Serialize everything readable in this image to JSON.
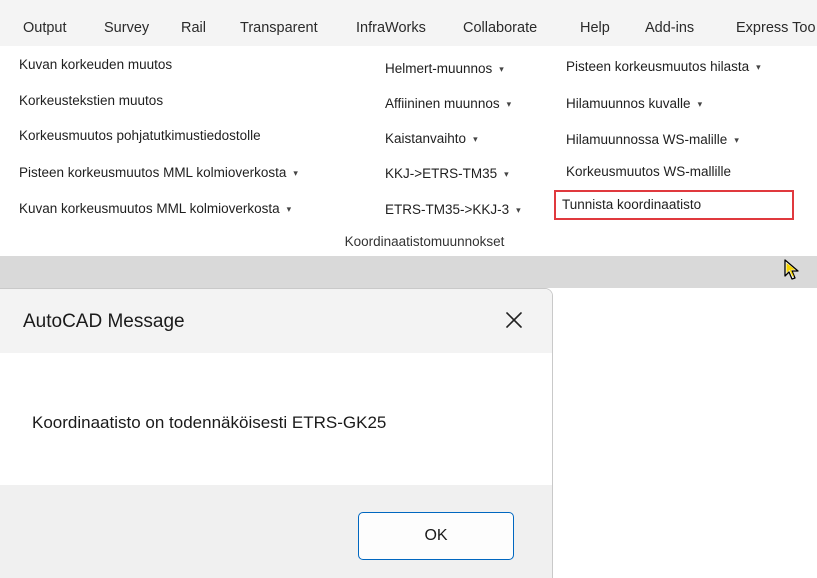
{
  "ribbon": {
    "tabs": [
      {
        "label": "Output"
      },
      {
        "label": "Survey"
      },
      {
        "label": "Rail"
      },
      {
        "label": "Transparent"
      },
      {
        "label": "InfraWorks"
      },
      {
        "label": "Collaborate"
      },
      {
        "label": "Help"
      },
      {
        "label": "Add-ins"
      },
      {
        "label": "Express Too"
      }
    ],
    "panel": {
      "title": "Koordinaatistomuunnokset",
      "col1": [
        {
          "label": "Kuvan korkeuden muutos"
        },
        {
          "label": "Korkeustekstien muutos"
        },
        {
          "label": "Korkeusmuutos pohjatutkimustiedostolle"
        },
        {
          "label": "Pisteen korkeusmuutos MML kolmioverkosta",
          "arrow": "▾"
        },
        {
          "label": "Kuvan korkeusmuutos MML kolmioverkosta",
          "arrow": "▾"
        }
      ],
      "col2": [
        {
          "label": "Helmert-muunnos",
          "arrow": "▾"
        },
        {
          "label": "Affiininen muunnos",
          "arrow": "▾"
        },
        {
          "label": "Kaistanvaihto",
          "arrow": "▾"
        },
        {
          "label": "KKJ->ETRS-TM35",
          "arrow": "▾"
        },
        {
          "label": "ETRS-TM35->KKJ-3",
          "arrow": "▾"
        }
      ],
      "col3": [
        {
          "label": "Pisteen korkeusmuutos hilasta",
          "arrow": "▾"
        },
        {
          "label": "Hilamuunnos kuvalle",
          "arrow": "▾"
        },
        {
          "label": "Hilamuunnossa WS-malille",
          "arrow": "▾"
        },
        {
          "label": "Korkeusmuutos WS-mallille"
        },
        {
          "label": "Tunnista koordinaatisto"
        }
      ]
    },
    "highlight_color": "#e0393e"
  },
  "cursor": {
    "icon": "mouse-pointer-icon"
  },
  "dialog": {
    "title": "AutoCAD Message",
    "close_icon": "close-icon",
    "message": "Koordinaatisto on todennäköisesti ETRS-GK25",
    "ok_label": "OK",
    "accent_color": "#0067c0"
  }
}
